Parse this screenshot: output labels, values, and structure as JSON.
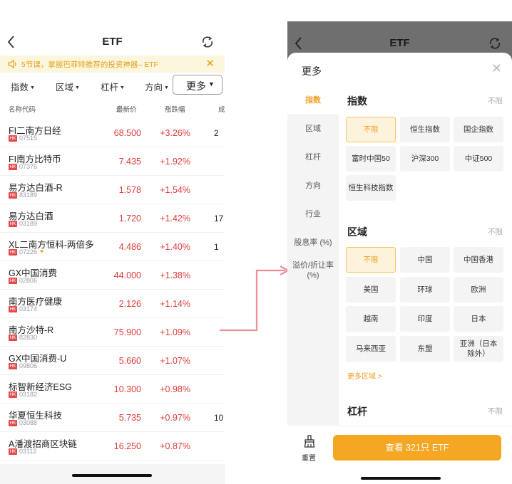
{
  "left": {
    "title": "ETF",
    "banner": {
      "text": "5节课，掌握巴菲特推荐的投资神器– ETF",
      "close": "✕"
    },
    "filters": [
      "指数",
      "区域",
      "杠杆",
      "方向"
    ],
    "more_label": "更多",
    "columns": {
      "name": "名称代码",
      "price": "最新价",
      "change": "涨跌幅",
      "extra": "成"
    },
    "rows": [
      {
        "name": "FI二南方日经",
        "code": "07515",
        "price": "68.500",
        "change": "+3.26%",
        "extra": "2"
      },
      {
        "name": "FI南方比特币",
        "code": "07376",
        "price": "7.435",
        "change": "+1.92%",
        "extra": ""
      },
      {
        "name": "易方达白酒-R",
        "code": "83189",
        "price": "1.578",
        "change": "+1.54%",
        "extra": ""
      },
      {
        "name": "易方达白酒",
        "code": "03189",
        "price": "1.720",
        "change": "+1.42%",
        "extra": "17"
      },
      {
        "name": "XL二南方恒科-两倍多",
        "code": "07226",
        "price": "4.486",
        "change": "+1.40%",
        "extra": "1"
      },
      {
        "name": "GX中国消费",
        "code": "02806",
        "price": "44.000",
        "change": "+1.38%",
        "extra": ""
      },
      {
        "name": "南方医疗健康",
        "code": "03174",
        "price": "2.126",
        "change": "+1.14%",
        "extra": ""
      },
      {
        "name": "南方沙特-R",
        "code": "82830",
        "price": "75.900",
        "change": "+1.09%",
        "extra": ""
      },
      {
        "name": "GX中国消费-U",
        "code": "09806",
        "price": "5.660",
        "change": "+1.07%",
        "extra": ""
      },
      {
        "name": "标智新经济ESG",
        "code": "03182",
        "price": "10.300",
        "change": "+0.98%",
        "extra": ""
      },
      {
        "name": "华夏恒生科技",
        "code": "03088",
        "price": "5.735",
        "change": "+0.97%",
        "extra": "10"
      },
      {
        "name": "A潘渡招商区块链",
        "code": "03112",
        "price": "16.250",
        "change": "+0.87%",
        "extra": ""
      }
    ],
    "hk_badge": "HK"
  },
  "right": {
    "title": "ETF",
    "sheet_title": "更多",
    "side": [
      "指数",
      "区域",
      "杠杆",
      "方向",
      "行业",
      "股息率 (%)",
      "溢价/折让率 (%)"
    ],
    "index": {
      "title": "指数",
      "any": "不限",
      "chips": [
        "不限",
        "恒生指数",
        "国企指数",
        "富时中国50",
        "沪深300",
        "中证500",
        "恒生科技指数"
      ]
    },
    "region": {
      "title": "区域",
      "any": "不限",
      "chips": [
        "不限",
        "中国",
        "中国香港",
        "美国",
        "环球",
        "欧洲",
        "越南",
        "印度",
        "日本",
        "马来西亚",
        "东盟",
        "亚洲（日本除外）"
      ],
      "more": "更多区域 >"
    },
    "leverage": {
      "title": "杠杆",
      "any": "不限"
    },
    "reset_label": "重置",
    "cta": "查看 321只 ETF"
  },
  "colors": {
    "accent": "#f5a623",
    "up": "#e03c3c",
    "banner_bg": "#fdf6de"
  }
}
